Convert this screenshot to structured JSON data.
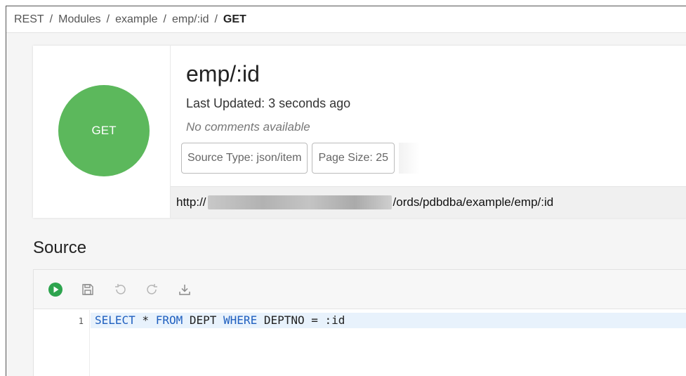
{
  "breadcrumb": {
    "items": [
      "REST",
      "Modules",
      "example",
      "emp/:id"
    ],
    "current": "GET"
  },
  "handler": {
    "method": "GET",
    "method_color": "#5cb85c",
    "title": "emp/:id",
    "last_updated": "Last Updated: 3 seconds ago",
    "comments": "No comments available",
    "source_type_chip": "Source Type: json/item",
    "page_size_chip": "Page Size: 25",
    "url_prefix": "http://",
    "url_suffix": "/ords/pdbdba/example/emp/:id"
  },
  "source": {
    "title": "Source",
    "toolbar_icons": [
      "run-icon",
      "save-icon",
      "undo-icon",
      "redo-icon",
      "download-icon"
    ],
    "run_color": "#2da44e",
    "line_number": "1",
    "code_tokens": [
      {
        "text": "SELECT",
        "kw": true
      },
      {
        "text": " * ",
        "kw": false
      },
      {
        "text": "FROM",
        "kw": true
      },
      {
        "text": " DEPT ",
        "kw": false
      },
      {
        "text": "WHERE",
        "kw": true
      },
      {
        "text": " DEPTNO = :id",
        "kw": false
      }
    ]
  }
}
